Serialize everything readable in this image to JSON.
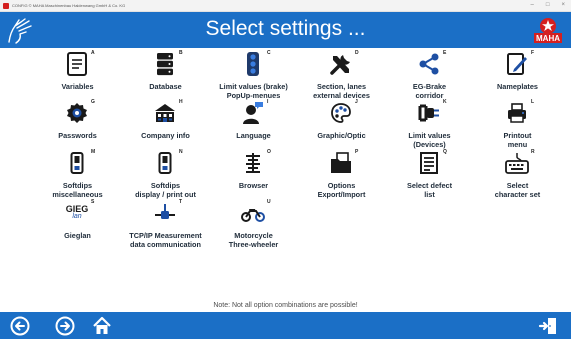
{
  "window": {
    "title": "CONFIG  © MAHA Maschinenbau Haldenwang GmbH & Co. KG",
    "minimize_icon": "minimize-icon",
    "maximize_icon": "maximize-icon",
    "close_icon": "close-icon"
  },
  "header": {
    "title": "Select settings ...",
    "bg_color": "#1b6fc6",
    "logo_text": "MAHA",
    "logo_color": "#d42020"
  },
  "tiles": [
    {
      "letter": "A",
      "label": "Variables",
      "icon": "document-icon"
    },
    {
      "letter": "B",
      "label": "Database",
      "icon": "database-icon"
    },
    {
      "letter": "C",
      "label": "Limit values (brake)\nPopUp-menues",
      "icon": "traffic-light-icon"
    },
    {
      "letter": "D",
      "label": "Section, lanes\nexternal devices",
      "icon": "tools-icon"
    },
    {
      "letter": "E",
      "label": "EG-Brake\ncorridor",
      "icon": "share-nodes-icon"
    },
    {
      "letter": "F",
      "label": "Nameplates",
      "icon": "edit-document-icon"
    },
    {
      "letter": "G",
      "label": "Passwords",
      "icon": "password-badge-icon"
    },
    {
      "letter": "H",
      "label": "Company info",
      "icon": "company-building-icon"
    },
    {
      "letter": "I",
      "label": "Language",
      "icon": "speaking-person-icon"
    },
    {
      "letter": "J",
      "label": "Graphic/Optic",
      "icon": "palette-icon"
    },
    {
      "letter": "K",
      "label": "Limit values\n(Devices)",
      "icon": "plug-icon"
    },
    {
      "letter": "L",
      "label": "Printout\nmenu",
      "icon": "printer-icon"
    },
    {
      "letter": "M",
      "label": "Softdips\nmiscellaneous",
      "icon": "switch-icon"
    },
    {
      "letter": "N",
      "label": "Softdips\ndisplay / print out",
      "icon": "switch-icon"
    },
    {
      "letter": "O",
      "label": "Browser",
      "icon": "browser-list-icon"
    },
    {
      "letter": "P",
      "label": "Options\nExport/Import",
      "icon": "folder-icon"
    },
    {
      "letter": "Q",
      "label": "Select defect\nlist",
      "icon": "defect-list-icon"
    },
    {
      "letter": "R",
      "label": "Select\ncharacter set",
      "icon": "keyboard-icon"
    },
    {
      "letter": "S",
      "label": "Gieglan",
      "icon": "gieglan-logo-icon",
      "logo_line1": "GIEG",
      "logo_line2": "lan"
    },
    {
      "letter": "T",
      "label": "TCP/IP Measurement\ndata communication",
      "icon": "network-icon"
    },
    {
      "letter": "U",
      "label": "Motorcycle\nThree-wheeler",
      "icon": "motorcycle-icon"
    }
  ],
  "note": "Note: Not all option combinations are possible!",
  "footer": {
    "back_icon": "back-arrow-icon",
    "forward_icon": "forward-arrow-icon",
    "home_icon": "home-icon",
    "exit_icon": "exit-icon"
  }
}
